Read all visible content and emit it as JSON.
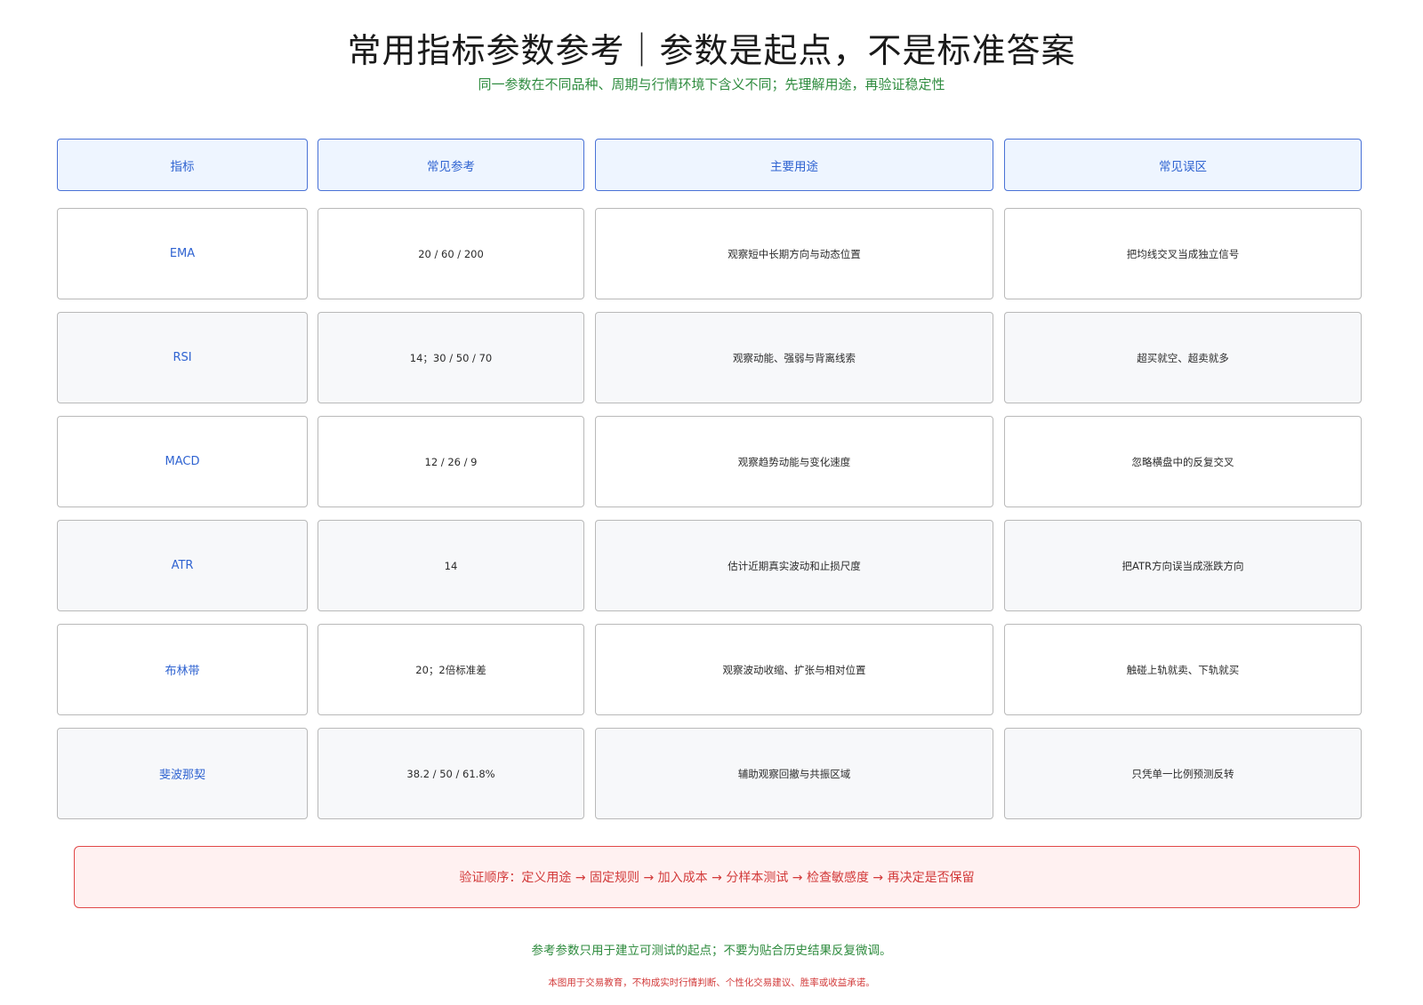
{
  "title": "常用指标参数参考｜参数是起点，不是标准答案",
  "subtitle": "同一参数在不同品种、周期与行情环境下含义不同；先理解用途，再验证稳定性",
  "table": {
    "headers": [
      "指标",
      "常见参考",
      "主要用途",
      "常见误区"
    ],
    "rows": [
      {
        "indicator": "EMA",
        "reference": "20 / 60 / 200",
        "purpose": "观察短中长期方向与动态位置",
        "pitfall": "把均线交叉当成独立信号"
      },
      {
        "indicator": "RSI",
        "reference": "14；30 / 50 / 70",
        "purpose": "观察动能、强弱与背离线索",
        "pitfall": "超买就空、超卖就多"
      },
      {
        "indicator": "MACD",
        "reference": "12 / 26 / 9",
        "purpose": "观察趋势动能与变化速度",
        "pitfall": "忽略横盘中的反复交叉"
      },
      {
        "indicator": "ATR",
        "reference": "14",
        "purpose": "估计近期真实波动和止损尺度",
        "pitfall": "把ATR方向误当成涨跌方向"
      },
      {
        "indicator": "布林带",
        "reference": "20；2倍标准差",
        "purpose": "观察波动收缩、扩张与相对位置",
        "pitfall": "触碰上轨就卖、下轨就买"
      },
      {
        "indicator": "斐波那契",
        "reference": "38.2 / 50 / 61.8%",
        "purpose": "辅助观察回撤与共振区域",
        "pitfall": "只凭单一比例预测反转"
      }
    ]
  },
  "verify_order": "验证顺序：定义用途 → 固定规则 → 加入成本 → 分样本测试 → 检查敏感度 → 再决定是否保留",
  "note": "参考参数只用于建立可测试的起点；不要为贴合历史结果反复微调。",
  "disclaimer": "本图用于交易教育，不构成实时行情判断、个性化交易建议、胜率或收益承诺。",
  "colors": {
    "accent_blue": "#2f63d1",
    "green": "#2e8b3e",
    "red": "#d23a3a"
  }
}
